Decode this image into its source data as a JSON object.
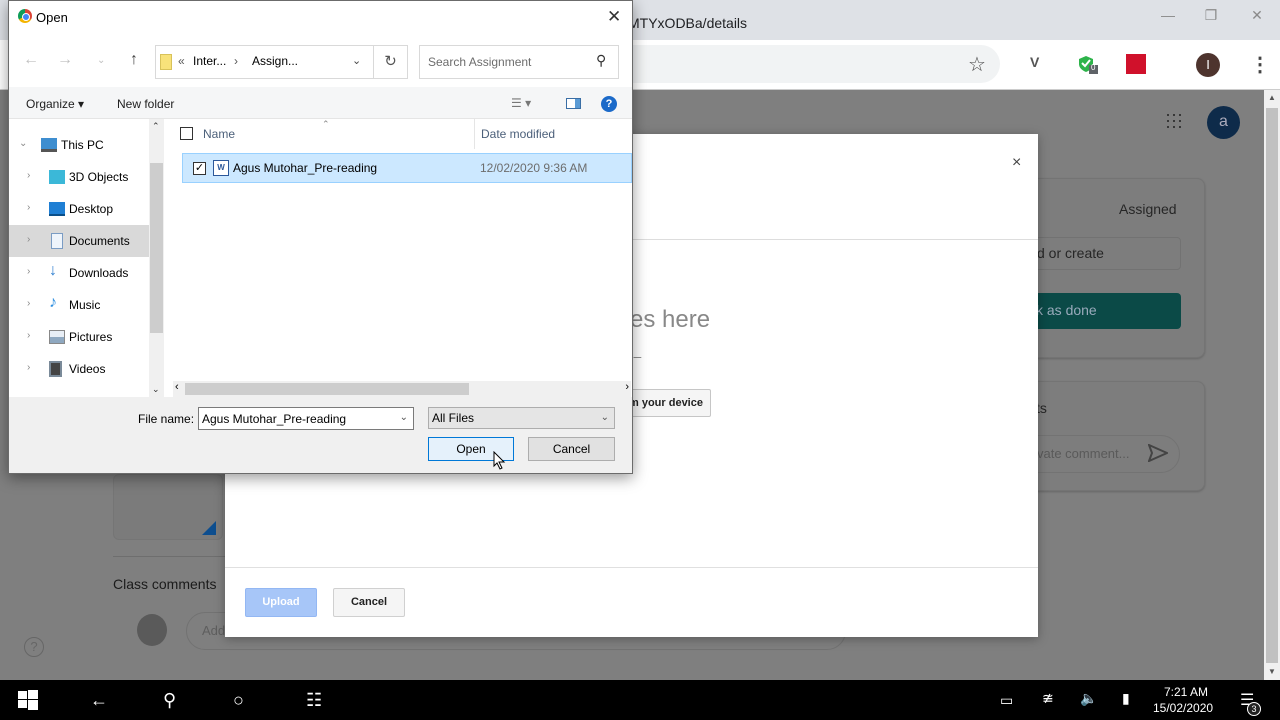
{
  "browser": {
    "url_fragment": "MTYxODBa/details",
    "window_controls": [
      "minimize",
      "restore",
      "close"
    ],
    "extensions": [
      {
        "name": "extension-v-icon"
      },
      {
        "name": "shield-check-icon",
        "badge": "0"
      },
      {
        "name": "mendeley-icon"
      }
    ],
    "profile_initial": "I"
  },
  "classroom": {
    "account_initial": "a",
    "status": "Assigned",
    "add_or_create": "d or create",
    "mark_as_done": "k as done",
    "private_comments_title": "ts",
    "private_comment_placeholder": "vate comment...",
    "class_comments_title": "Class comments",
    "class_comment_placeholder": "Add",
    "help": "?"
  },
  "upload_modal": {
    "drag_text": "es here",
    "or_text": "r –",
    "select_device": "m your device",
    "upload_label": "Upload",
    "cancel_label": "Cancel",
    "close": "×"
  },
  "open_dialog": {
    "title": "Open",
    "breadcrumb": [
      "Inter...",
      "Assign..."
    ],
    "search_placeholder": "Search Assignment",
    "organize_label": "Organize ▾",
    "new_folder_label": "New folder",
    "nav_items": [
      {
        "label": "This PC",
        "icon": "computer-icon",
        "expanded": true
      },
      {
        "label": "3D Objects",
        "icon": "cube-icon"
      },
      {
        "label": "Desktop",
        "icon": "desktop-icon"
      },
      {
        "label": "Documents",
        "icon": "document-icon",
        "selected": true
      },
      {
        "label": "Downloads",
        "icon": "download-icon"
      },
      {
        "label": "Music",
        "icon": "music-icon"
      },
      {
        "label": "Pictures",
        "icon": "pictures-icon"
      },
      {
        "label": "Videos",
        "icon": "videos-icon"
      }
    ],
    "columns": {
      "name": "Name",
      "date": "Date modified"
    },
    "files": [
      {
        "name": "Agus Mutohar_Pre-reading",
        "date": "12/02/2020 9:36 AM",
        "selected": true,
        "type": "word"
      }
    ],
    "file_name_label": "File name:",
    "file_name_value": "Agus Mutohar_Pre-reading",
    "file_type": "All Files",
    "open_label": "Open",
    "cancel_label": "Cancel"
  },
  "taskbar": {
    "time": "7:21 AM",
    "date": "15/02/2020",
    "notification_count": "3"
  }
}
